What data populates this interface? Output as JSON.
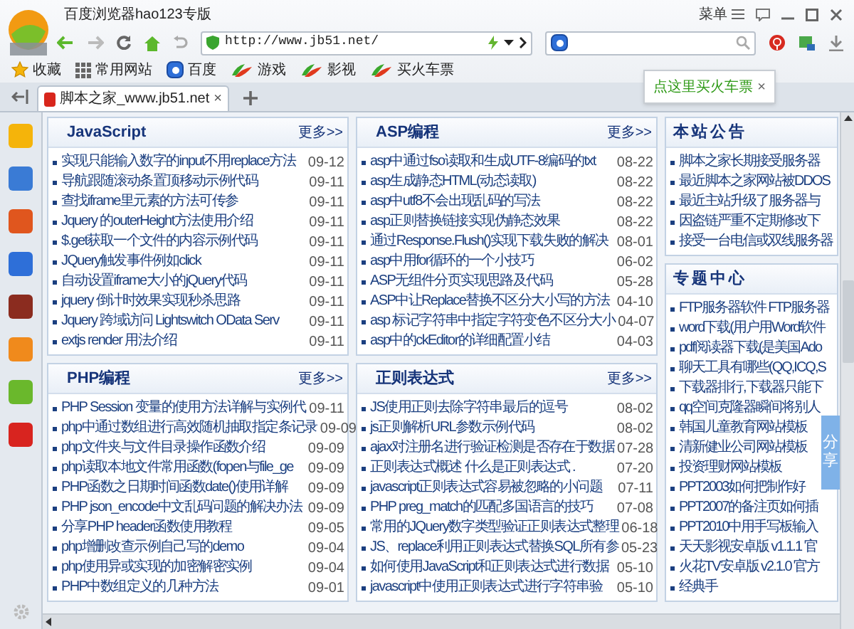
{
  "app": {
    "title": "百度浏览器hao123专版",
    "menu_label": "菜单"
  },
  "address": {
    "url": "http://www.jb51.net/"
  },
  "bookmarks": [
    {
      "label": "收藏",
      "kind": "favorites"
    },
    {
      "label": "常用网站",
      "kind": "grid"
    },
    {
      "label": "百度",
      "kind": "paw"
    },
    {
      "label": "游戏",
      "kind": "hao"
    },
    {
      "label": "影视",
      "kind": "hao"
    },
    {
      "label": "买火车票",
      "kind": "hao"
    }
  ],
  "popup": {
    "text": "点这里买火车票",
    "close": "×"
  },
  "tabs": [
    {
      "label": "脚本之家_www.jb51.net",
      "selected": true,
      "close": "×"
    }
  ],
  "columns": [
    [
      {
        "title": "JavaScript",
        "more": "更多>>",
        "items": [
          {
            "text": "实现只能输入数字的input不用replace方法",
            "date": "09-12"
          },
          {
            "text": "导航跟随滚动条置顶移动示例代码",
            "date": "09-11"
          },
          {
            "text": "查找iframe里元素的方法可传参",
            "date": "09-11"
          },
          {
            "text": "Jquery 的outerHeight方法使用介绍",
            "date": "09-11"
          },
          {
            "text": "$.get获取一个文件的内容示例代码",
            "date": "09-11"
          },
          {
            "text": "JQuery触发事件例如click",
            "date": "09-11"
          },
          {
            "text": "自动设置iframe大小的jQuery代码",
            "date": "09-11"
          },
          {
            "text": "jquery 倒计时效果实现秒杀思路",
            "date": "09-11"
          },
          {
            "text": "Jquery 跨域访问 Lightswitch OData Serv",
            "date": "09-11"
          },
          {
            "text": "extjs render 用法介绍",
            "date": "09-11"
          }
        ]
      },
      {
        "title": "PHP编程",
        "more": "更多>>",
        "items": [
          {
            "text": "PHP Session 变量的使用方法详解与实例代",
            "date": "09-11"
          },
          {
            "text": "php中通过数组进行高效随机抽取指定条记录",
            "date": "09-09"
          },
          {
            "text": "php文件夹与文件目录操作函数介绍",
            "date": "09-09"
          },
          {
            "text": "php读取本地文件常用函数(fopen与file_ge",
            "date": "09-09"
          },
          {
            "text": "PHP函数之日期时间函数date()使用详解",
            "date": "09-09"
          },
          {
            "text": "PHP json_encode中文乱码问题的解决办法",
            "date": "09-09"
          },
          {
            "text": "分享PHP header函数使用教程",
            "date": "09-05"
          },
          {
            "text": "php增删改查示例自己写的demo",
            "date": "09-04"
          },
          {
            "text": "php使用异或实现的加密解密实例",
            "date": "09-04"
          },
          {
            "text": "PHP中数组定义的几种方法",
            "date": "09-01"
          }
        ]
      }
    ],
    [
      {
        "title": "ASP编程",
        "more": "更多>>",
        "items": [
          {
            "text": "asp中通过fso读取和生成UTF-8编码的txt",
            "date": "08-22"
          },
          {
            "text": "asp生成静态HTML(动态读取)",
            "date": "08-22"
          },
          {
            "text": "asp中utf8不会出现乱码的写法",
            "date": "08-22"
          },
          {
            "text": "asp正则替换链接实现伪静态效果",
            "date": "08-22"
          },
          {
            "text": "通过Response.Flush()实现下载失败的解决",
            "date": "08-01"
          },
          {
            "text": "asp中用for循环的一个小技巧",
            "date": "06-02"
          },
          {
            "text": "ASP无组件分页实现思路及代码",
            "date": "05-28"
          },
          {
            "text": "ASP中让Replace替换不区分大小写的方法",
            "date": "04-10"
          },
          {
            "text": "asp 标记字符串中指定字符变色不区分大小",
            "date": "04-07"
          },
          {
            "text": "asp中的ckEditor的详细配置小结",
            "date": "04-03"
          }
        ]
      },
      {
        "title": "正则表达式",
        "more": "更多>>",
        "items": [
          {
            "text": "JS使用正则去除字符串最后的逗号",
            "date": "08-02"
          },
          {
            "text": "js正则解析URL参数示例代码",
            "date": "08-02"
          },
          {
            "text": "ajax对注册名进行验证检测是否存在于数据",
            "date": "07-28"
          },
          {
            "text": "正则表达式概述 什么是正则表达式 .",
            "date": "07-20"
          },
          {
            "text": "javascript正则表达式容易被忽略的小问题",
            "date": "07-11"
          },
          {
            "text": "PHP preg_match的匹配多国语言的技巧",
            "date": "07-08"
          },
          {
            "text": "常用的JQuery数字类型验证正则表达式整理",
            "date": "06-18"
          },
          {
            "text": "JS、replace利用正则表达式替换SQL所有参",
            "date": "05-23"
          },
          {
            "text": "如何使用JavaScript和正则表达式进行数据",
            "date": "05-10"
          },
          {
            "text": "javascript中使用正则表达式进行字符串验",
            "date": "05-10"
          }
        ]
      }
    ],
    [
      {
        "title": "本站公告",
        "items": [
          {
            "text": "脚本之家长期接受服务器"
          },
          {
            "text": "最近脚本之家网站被DDOS"
          },
          {
            "text": "最近主站升级了服务器与"
          },
          {
            "text": "因盗链严重不定期修改下"
          },
          {
            "text": "接受一台电信或双线服务器"
          }
        ]
      },
      {
        "title": "专题中心",
        "items": [
          {
            "text": "FTP服务器软件 FTP服务器"
          },
          {
            "text": "word下载(用户用Word软件"
          },
          {
            "text": "pdf阅读器下载(是美国Ado"
          },
          {
            "text": "聊天工具有哪些(QQ,ICQ,S"
          },
          {
            "text": "下载器排行,下载器只能下"
          },
          {
            "text": "qq空间克隆器瞬间将别人"
          },
          {
            "text": "韩国儿童教育网站模板"
          },
          {
            "text": "清新健业公司网站模板"
          },
          {
            "text": "投资理财网站模板"
          },
          {
            "text": "PPT2003如何把制作好"
          },
          {
            "text": "PPT2007的备注页如何插"
          },
          {
            "text": "PPT2010中用手写板输入"
          },
          {
            "text": "天天影视安卓版 v1.1.1 官"
          },
          {
            "text": "火花TV安卓版 v2.1.0 官方"
          },
          {
            "text": "经典手"
          }
        ]
      }
    ]
  ],
  "share": {
    "label": "分享"
  }
}
